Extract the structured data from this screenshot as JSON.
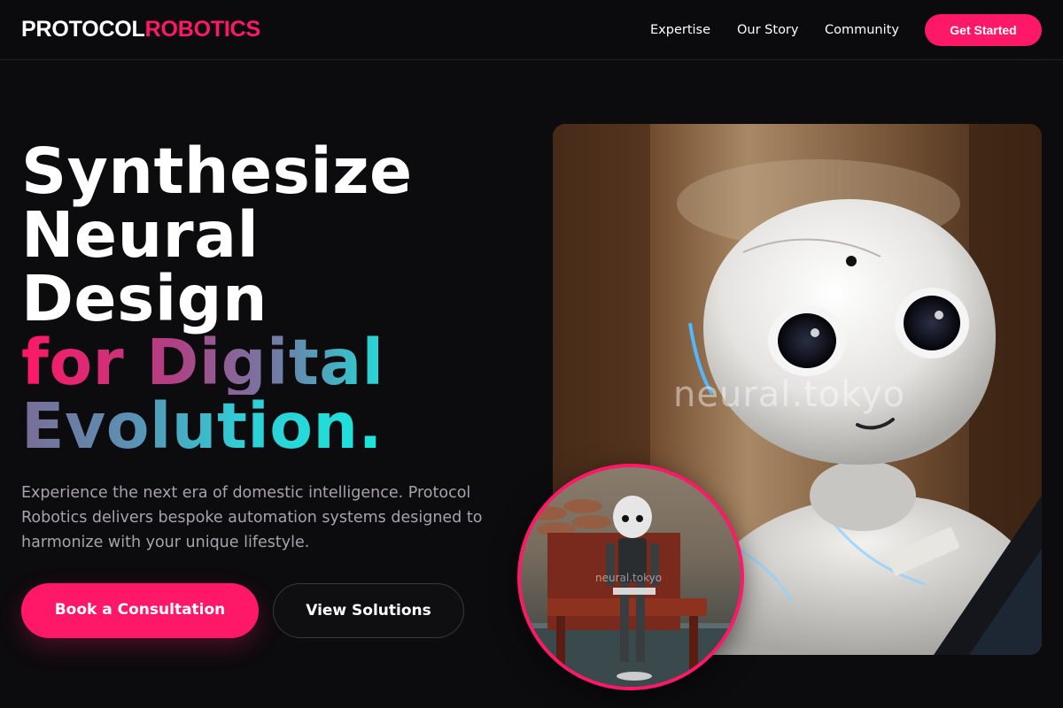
{
  "brand": {
    "name_part1": "PROTOCOL",
    "name_part2": "ROBOTICS",
    "accent": "#ff1867"
  },
  "nav": {
    "items": [
      "Expertise",
      "Our Story",
      "Community"
    ],
    "cta_label": "Get Started"
  },
  "hero": {
    "headline_lines": [
      "Synthesize",
      "Neural",
      "Design"
    ],
    "headline_accent_line1": "for Digital",
    "headline_accent_line2": "Evolution.",
    "subtitle": "Experience the next era of domestic intelligence. Protocol Robotics delivers bespoke automation systems designed to harmonize with your unique lifestyle.",
    "primary_button": "Book a Consultation",
    "secondary_button": "View Solutions",
    "image_watermark": "neural.tokyo",
    "circle_watermark": "neural.tokyo"
  },
  "colors": {
    "background": "#0c0b0d",
    "accent": "#ff1867",
    "teal": "#1ee3dc",
    "muted_text": "#a6a3ab"
  }
}
